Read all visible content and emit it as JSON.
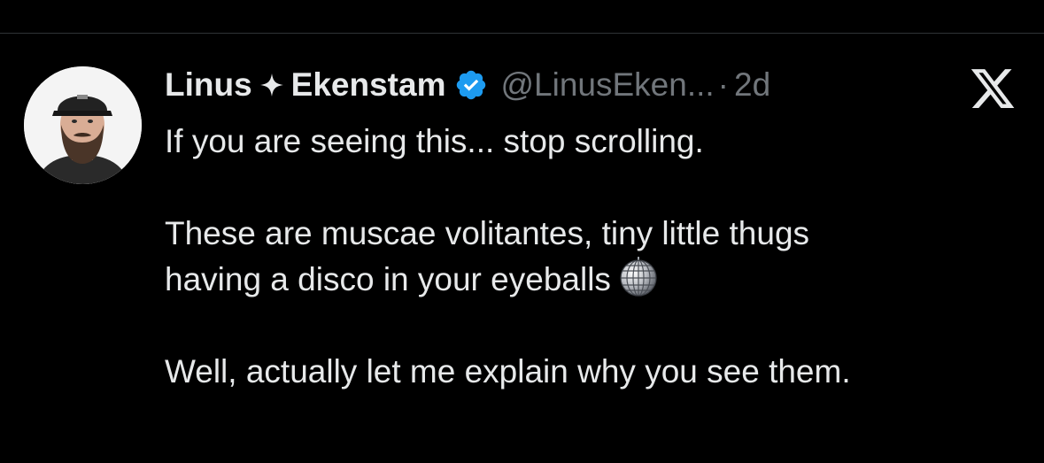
{
  "tweet": {
    "author_first": "Linus",
    "author_last": "Ekenstam",
    "handle": "@LinusEken...",
    "separator": "·",
    "time": "2d",
    "lines": [
      "If you are seeing this... stop scrolling.",
      "These are muscae volitantes, tiny little thugs",
      "having a disco in your eyeballs",
      "Well, actually let me explain why you see them."
    ]
  },
  "icons": {
    "avatar": "profile-photo",
    "name_separator": "four-point-star-icon",
    "verified": "verified-badge-icon",
    "logo": "x-logo-icon",
    "emoji": "mirror-ball-emoji"
  },
  "colors": {
    "background": "#000000",
    "text": "#e7e9ea",
    "muted": "#71767b",
    "verified": "#1d9bf0"
  }
}
